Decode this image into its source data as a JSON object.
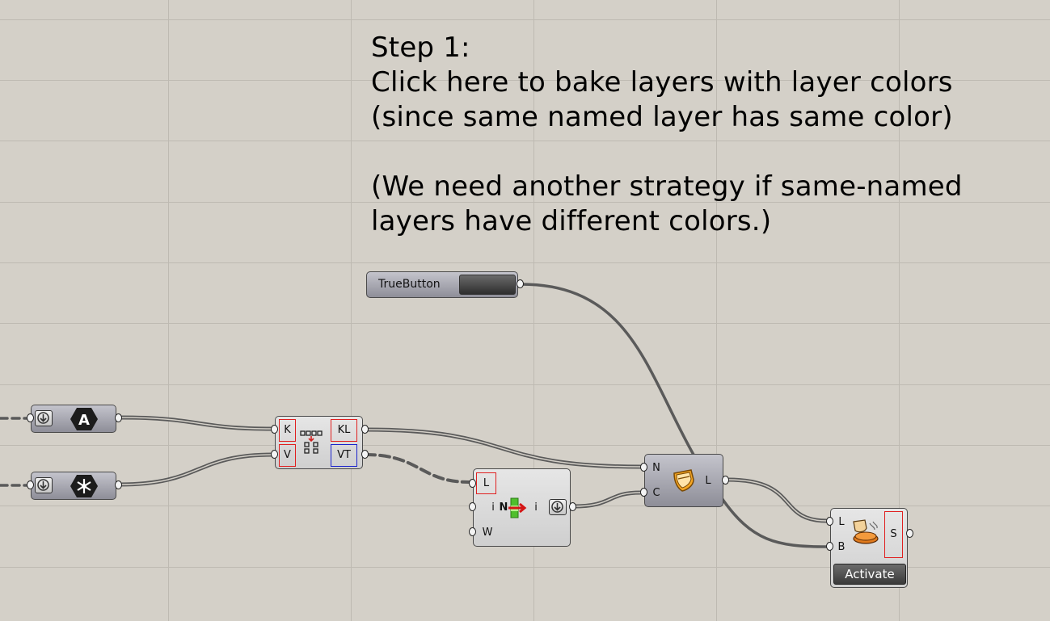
{
  "note": {
    "lines": [
      "Step 1:",
      "Click here to bake layers with layer colors",
      "(since same named layer has same color)",
      "",
      "(We need another strategy if same-named",
      "layers have different colors.)"
    ]
  },
  "true_button": {
    "label": "TrueButton"
  },
  "sift_component": {
    "inputs": [
      "K",
      "V"
    ],
    "outputs": [
      "KL",
      "VT"
    ]
  },
  "list_item_component": {
    "inputs": [
      "L",
      "i",
      "W"
    ],
    "center_label": "N",
    "output": "i"
  },
  "layer_component": {
    "inputs": [
      "N",
      "C"
    ],
    "output": "L"
  },
  "bake_component": {
    "inputs": [
      "L",
      "B"
    ],
    "output": "S",
    "activate_label": "Activate"
  },
  "icons": {
    "text_param": "letter-a-hex-icon",
    "geometry_param": "geometry-hex-icon",
    "sift": "sift-pattern-icon",
    "list_item": "list-item-icon",
    "layer": "layer-shield-icon",
    "bake": "bake-pie-icon",
    "dropdown": "arrow-down-icon"
  },
  "colors": {
    "canvas": "#d4d0c8",
    "grid": "#bebab2",
    "wire": "#5a5a5a",
    "highlight_red": "#e02020",
    "highlight_blue": "#1a22cc"
  }
}
